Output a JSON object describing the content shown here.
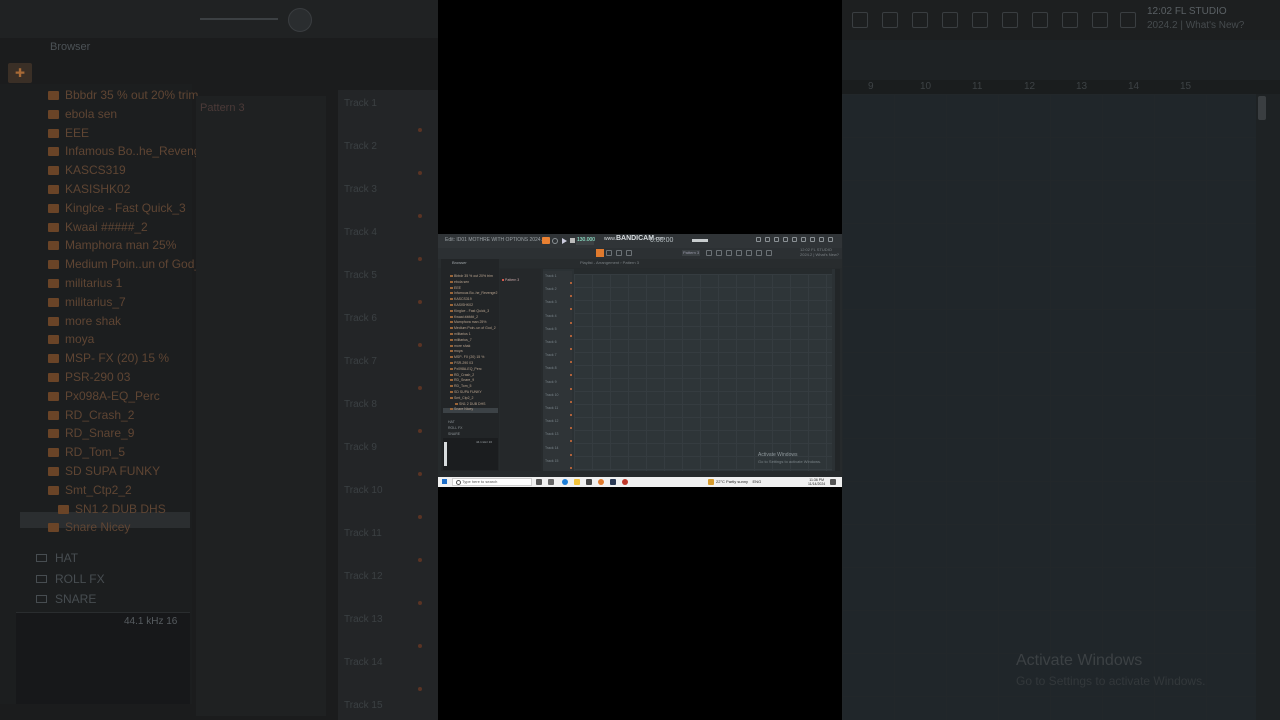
{
  "background_left": {
    "browser_title": "Browser",
    "items": [
      "Bbbdr 35 % out 20% trim",
      "ebola sen",
      "EEE",
      "Infamous Bo..he_Revenge2",
      "KASCS319",
      "KASISHK02",
      "Kinglce - Fast Quick_3",
      "Kwaai #####_2",
      "Mamphora man 25%",
      "Medium Poin..un of God_2",
      "militarius 1",
      "militarius_7",
      "more shak",
      "moya",
      "MSP- FX (20) 15 %",
      "PSR-290 03",
      "Px098A-EQ_Perc",
      "RD_Crash_2",
      "RD_Snare_9",
      "RD_Tom_5",
      "SD SUPA FUNKY",
      "Smt_Ctp2_2",
      "SN1 2 DUB DHS",
      "Snare Nicey"
    ],
    "folders": [
      "HAT",
      "ROLL FX",
      "SNARE"
    ],
    "wave_label": "44.1 kHz 16",
    "pattern": "Pattern 3",
    "tracks": [
      "Track 1",
      "Track 2",
      "Track 3",
      "Track 4",
      "Track 5",
      "Track 6",
      "Track 7",
      "Track 8",
      "Track 9",
      "Track 10",
      "Track 11",
      "Track 12",
      "Track 13",
      "Track 14",
      "Track 15"
    ]
  },
  "background_right": {
    "clock": "12:02",
    "brand": "FL STUDIO",
    "version": "2024.2 | What's New?",
    "ruler_numbers": [
      "9",
      "10",
      "11",
      "12",
      "13",
      "14",
      "15"
    ],
    "activate_title": "Activate Windows",
    "activate_sub": "Go to Settings to activate Windows."
  },
  "screenshot": {
    "file_title": "Edit: ID01 MOTHRE WITH OPTIONS 2024.flp",
    "tempo": "130.000",
    "bandicam_www": "www.",
    "bandicam": "BANDICAM",
    "bandicam_com": ".com",
    "timecode": "0:00:00",
    "pattern_box": "Pattern 3",
    "fl_brand_1": "12:02 FL STUDIO",
    "fl_brand_2": "2024.2 | What's New?",
    "toolbar3_text": "Playlist - Arrangement  › Pattern 3",
    "browser_title": "Browser",
    "channel_pattern": "Pattern 3",
    "wave_label": "44.1 kHz 16",
    "activate_title": "Activate Windows",
    "activate_sub": "Go to Settings to activate Windows.",
    "search_placeholder": "Type here to search",
    "weather": "22°C  Partly sunny",
    "language": "ENG",
    "time": "11:36 PM",
    "date": "11/14/2024"
  },
  "colors": {
    "accent": "#e07a2e",
    "browser_item": "#b9a48f",
    "taskbar": "#f0f0f0"
  }
}
